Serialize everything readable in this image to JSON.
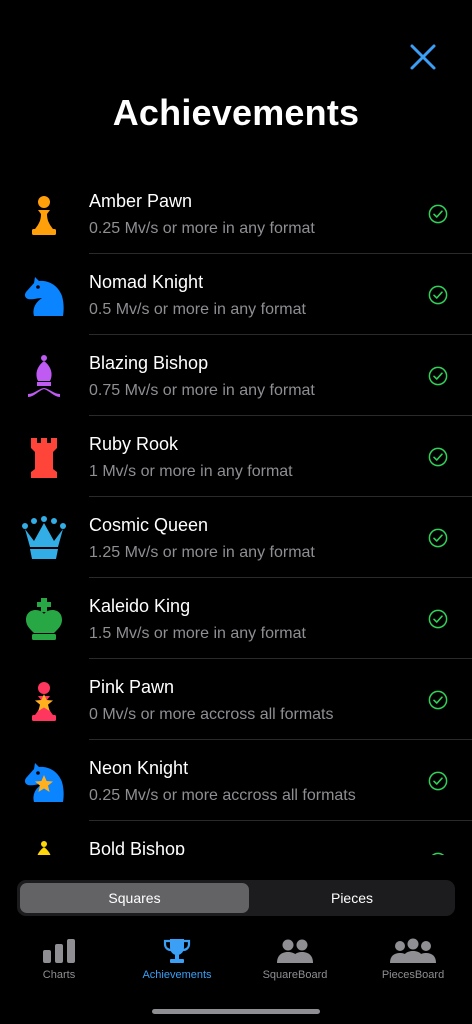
{
  "screen": {
    "title": "Achievements",
    "close_icon": "close-icon"
  },
  "achievements": [
    {
      "name": "Amber Pawn",
      "desc": "0.25 Mv/s or more in any format",
      "piece": "pawn",
      "color": "#ff9f0a",
      "completed": true
    },
    {
      "name": "Nomad Knight",
      "desc": "0.5 Mv/s or more in any format",
      "piece": "knight",
      "color": "#0a84ff",
      "completed": true
    },
    {
      "name": "Blazing Bishop",
      "desc": "0.75 Mv/s or more in any format",
      "piece": "bishop",
      "color": "#bf5af2",
      "completed": true
    },
    {
      "name": "Ruby Rook",
      "desc": "1 Mv/s or more in any format",
      "piece": "rook",
      "color": "#ff453a",
      "completed": true
    },
    {
      "name": "Cosmic Queen",
      "desc": "1.25 Mv/s or more in any format",
      "piece": "queen",
      "color": "#32ade6",
      "completed": true
    },
    {
      "name": "Kaleido King",
      "desc": "1.5 Mv/s or more in any format",
      "piece": "king",
      "color": "#28a745",
      "completed": true
    },
    {
      "name": "Pink Pawn",
      "desc": "0 Mv/s or more accross all formats",
      "piece": "pawn",
      "color": "#ff375f",
      "star": true,
      "completed": true
    },
    {
      "name": "Neon Knight",
      "desc": "0.25 Mv/s or more accross all formats",
      "piece": "knight",
      "color": "#0a84ff",
      "star": true,
      "completed": true
    },
    {
      "name": "Bold Bishop",
      "desc": "",
      "piece": "bishop",
      "color": "#ffd60a",
      "completed": true
    }
  ],
  "segmented": {
    "options": [
      "Squares",
      "Pieces"
    ],
    "selected": "Squares"
  },
  "tabbar": {
    "tabs": [
      {
        "label": "Charts",
        "icon": "bar-chart-icon"
      },
      {
        "label": "Achievements",
        "icon": "trophy-icon"
      },
      {
        "label": "SquareBoard",
        "icon": "two-people-icon"
      },
      {
        "label": "PiecesBoard",
        "icon": "three-people-icon"
      }
    ],
    "active": "Achievements"
  },
  "colors": {
    "accent": "#3a9ff5",
    "check": "#30d158",
    "background": "#000000",
    "secondary_text": "#8e8e93"
  }
}
